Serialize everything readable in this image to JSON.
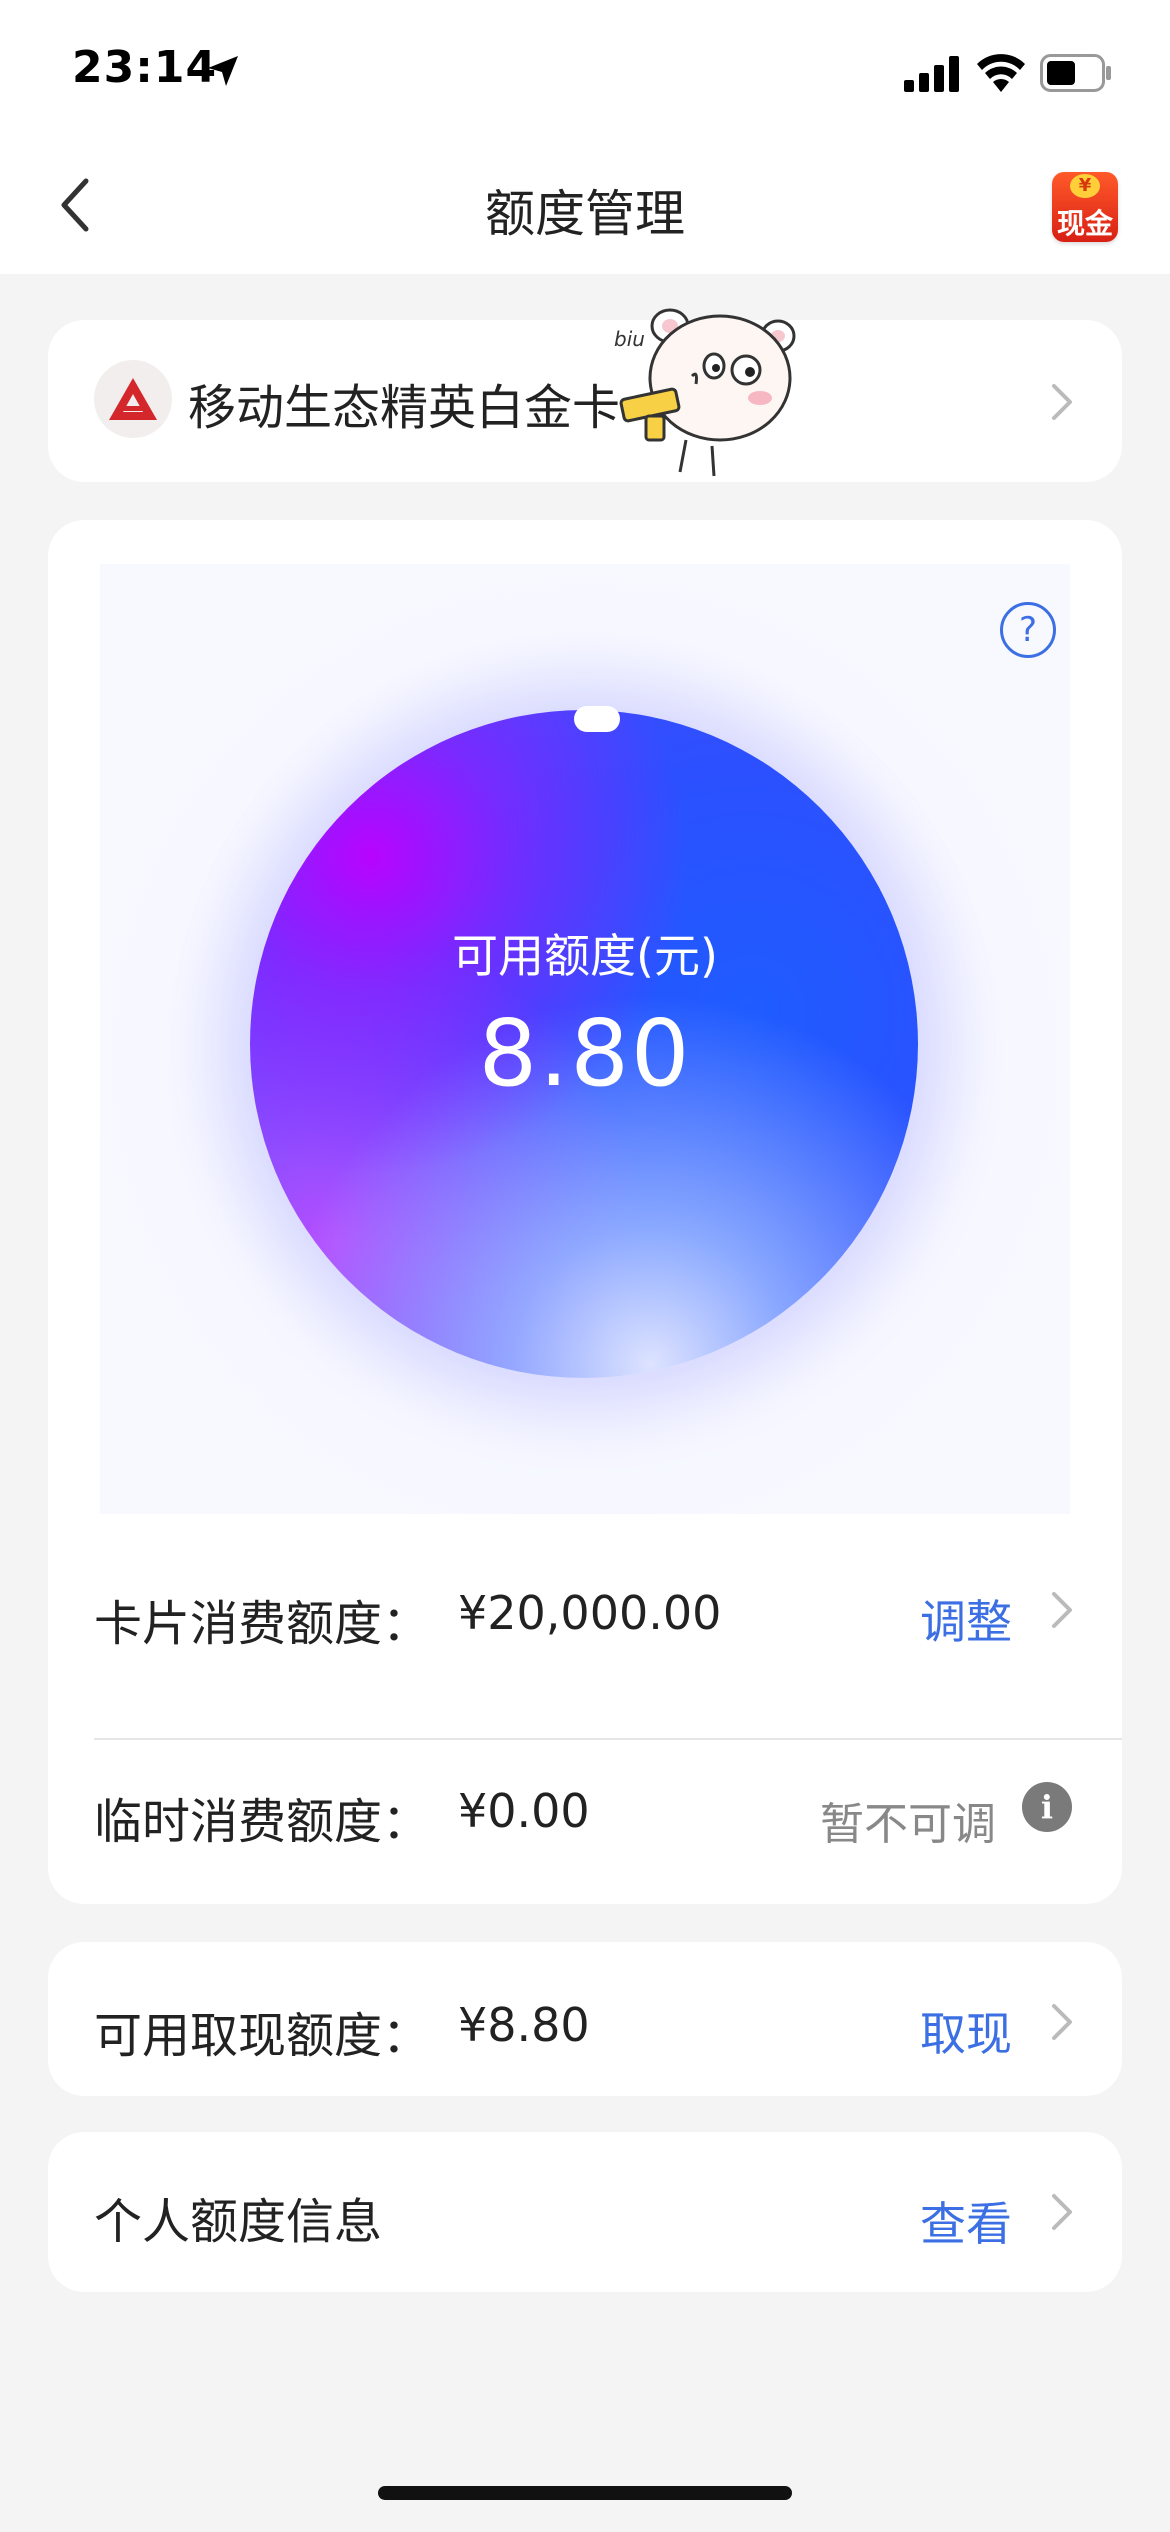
{
  "status_bar": {
    "time": "23:14"
  },
  "nav": {
    "title": "额度管理",
    "cash_badge_coin": "¥",
    "cash_badge_label": "现金"
  },
  "card": {
    "name": "移动生态精英白金卡"
  },
  "credit": {
    "help_symbol": "?",
    "available_label": "可用额度(元)",
    "available_value": "8.80"
  },
  "rows": {
    "card_limit": {
      "label": "卡片消费额度：",
      "value": "¥20,000.00",
      "action": "调整"
    },
    "temp_limit": {
      "label": "临时消费额度：",
      "value": "¥0.00",
      "status": "暂不可调",
      "info_symbol": "i"
    },
    "cash_limit": {
      "label": "可用取现额度：",
      "value": "¥8.80",
      "action": "取现"
    },
    "personal": {
      "label": "个人额度信息",
      "action": "查看"
    }
  },
  "colors": {
    "accent": "#3b6fe3",
    "background": "#f4f4f4",
    "orb_primary": "#1f5cff",
    "orb_secondary": "#be00ff"
  }
}
